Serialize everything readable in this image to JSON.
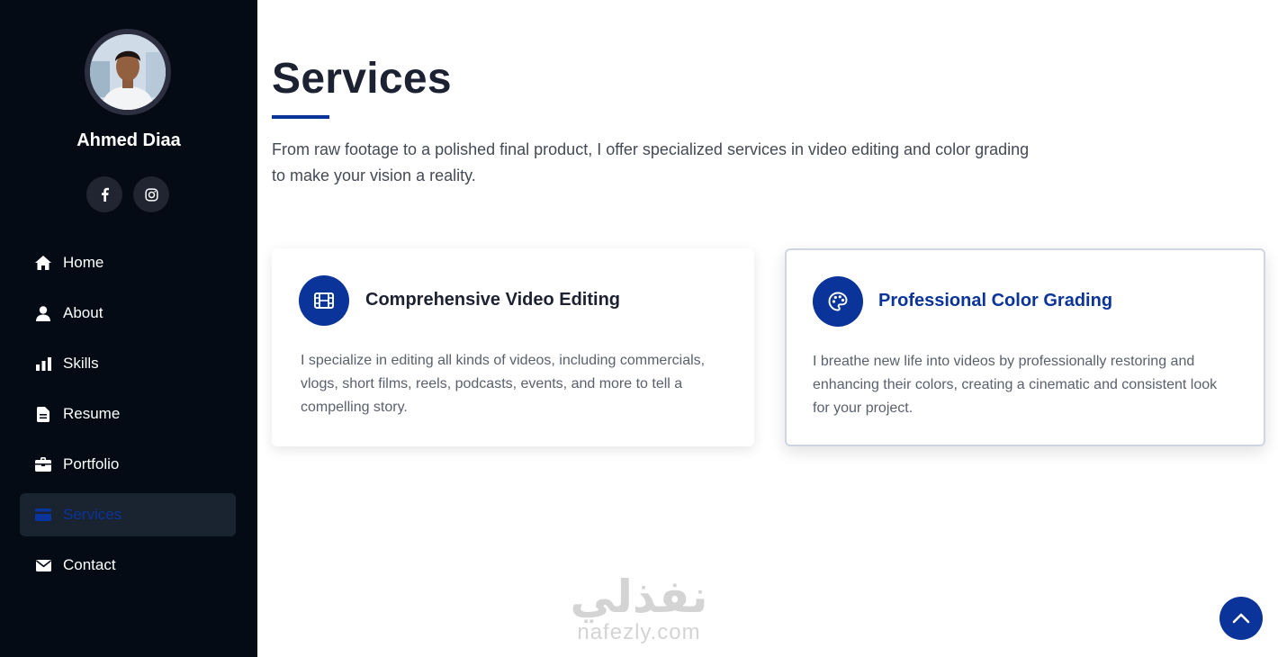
{
  "sidebar": {
    "profile_name": "Ahmed Diaa",
    "social": [
      {
        "icon": "facebook-icon"
      },
      {
        "icon": "instagram-icon"
      }
    ],
    "nav": [
      {
        "label": "Home",
        "icon": "home-icon"
      },
      {
        "label": "About",
        "icon": "user-icon"
      },
      {
        "label": "Skills",
        "icon": "bar-chart-icon"
      },
      {
        "label": "Resume",
        "icon": "document-icon"
      },
      {
        "label": "Portfolio",
        "icon": "briefcase-icon"
      },
      {
        "label": "Services",
        "icon": "card-icon",
        "active": true
      },
      {
        "label": "Contact",
        "icon": "envelope-icon"
      }
    ]
  },
  "main": {
    "title": "Services",
    "intro": "From raw footage to a polished final product, I offer specialized services in video editing and color grading to make your vision a reality.",
    "cards": [
      {
        "icon": "film-icon",
        "title": "Comprehensive Video Editing",
        "description": "I specialize in editing all kinds of videos, including commercials, vlogs, short films, reels, podcasts, events, and more to tell a compelling story."
      },
      {
        "icon": "palette-icon",
        "title": "Professional Color Grading",
        "description": "I breathe new life into videos by professionally restoring and enhancing their colors, creating a cinematic and consistent look for your project."
      }
    ]
  },
  "watermark": {
    "arabic": "نفذلي",
    "latin": "nafezly.com"
  },
  "colors": {
    "sidebar_bg": "#040b14",
    "accent": "#0a3499",
    "active_nav_bg": "#1a2330"
  }
}
